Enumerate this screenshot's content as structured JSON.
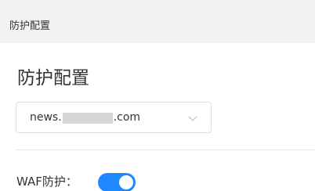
{
  "breadcrumb": {
    "label": "防护配置"
  },
  "main": {
    "title": "防护配置",
    "domain_select": {
      "value_prefix": "news.",
      "value_suffix": ".com",
      "icon": "chevron-down-icon"
    },
    "waf": {
      "label": "WAF防护：",
      "enabled": true
    }
  },
  "colors": {
    "accent": "#1e88ff",
    "header_bg": "#f2f2f2",
    "border": "#dcdfe6"
  }
}
